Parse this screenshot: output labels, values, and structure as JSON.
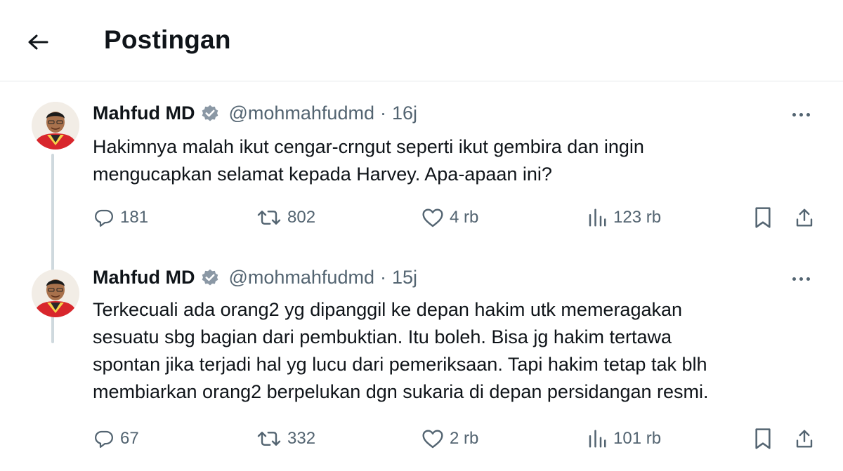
{
  "header": {
    "title": "Postingan"
  },
  "tweets": [
    {
      "name": "Mahfud MD",
      "handle": "@mohmahfudmd",
      "dot": "·",
      "time": "16j",
      "lines": [
        "Hakimnya malah ikut cengar-crngut seperti ikut gembira dan ingin",
        "mengucapkan selamat kepada Harvey. Apa-apaan ini?"
      ],
      "replies": "181",
      "reposts": "802",
      "likes": "4 rb",
      "views": "123 rb"
    },
    {
      "name": "Mahfud MD",
      "handle": "@mohmahfudmd",
      "dot": "·",
      "time": "15j",
      "lines": [
        "Terkecuali ada orang2 yg dipanggil ke depan hakim utk memeragakan",
        "sesuatu sbg bagian dari pembuktian. Itu boleh. Bisa jg hakim tertawa",
        "spontan jika terjadi hal yg lucu dari pemeriksaan. Tapi hakim  tetap tak blh",
        "membiarkan orang2 berpelukan dgn sukaria di depan persidangan resmi."
      ],
      "replies": "67",
      "reposts": "332",
      "likes": "2 rb",
      "views": "101 rb"
    }
  ],
  "colors": {
    "verified_badge": "#8b98a5",
    "secondary_text": "#536471",
    "divider": "#e6e8ea"
  },
  "icons": [
    "back-arrow-icon",
    "verified-badge-icon",
    "more-icon",
    "reply-icon",
    "repost-icon",
    "like-icon",
    "views-icon",
    "bookmark-icon",
    "share-icon"
  ]
}
